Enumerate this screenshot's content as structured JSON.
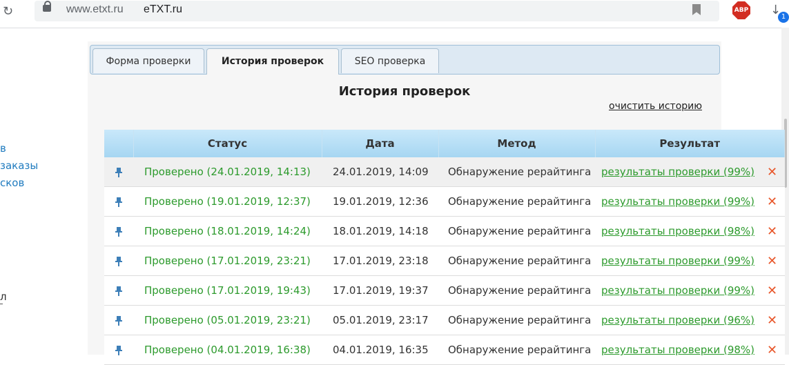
{
  "browser": {
    "url_domain": "www.etxt.ru",
    "page_title": "eTXT.ru",
    "abp_label": "ABP",
    "downloads_badge": "1"
  },
  "sidebar": {
    "fragments": [
      "в",
      "заказы",
      "сков",
      "л"
    ]
  },
  "tabs": [
    {
      "label": "Форма проверки",
      "active": false
    },
    {
      "label": "История проверок",
      "active": true
    },
    {
      "label": "SEO проверка",
      "active": false
    }
  ],
  "heading": "История проверок",
  "clear_link": "очистить историю",
  "table": {
    "headers": [
      "Статус",
      "Дата",
      "Метод",
      "Результат"
    ],
    "rows": [
      {
        "status": "Проверено (24.01.2019, 14:13)",
        "date": "24.01.2019, 14:09",
        "method": "Обнаружение рерайтинга",
        "result": "результаты проверки (99%)"
      },
      {
        "status": "Проверено (19.01.2019, 12:37)",
        "date": "19.01.2019, 12:36",
        "method": "Обнаружение рерайтинга",
        "result": "результаты проверки (99%)"
      },
      {
        "status": "Проверено (18.01.2019, 14:24)",
        "date": "18.01.2019, 14:18",
        "method": "Обнаружение рерайтинга",
        "result": "результаты проверки (98%)"
      },
      {
        "status": "Проверено (17.01.2019, 23:21)",
        "date": "17.01.2019, 23:18",
        "method": "Обнаружение рерайтинга",
        "result": "результаты проверки (99%)"
      },
      {
        "status": "Проверено (17.01.2019, 19:43)",
        "date": "17.01.2019, 19:37",
        "method": "Обнаружение рерайтинга",
        "result": "результаты проверки (99%)"
      },
      {
        "status": "Проверено (05.01.2019, 23:21)",
        "date": "05.01.2019, 23:17",
        "method": "Обнаружение рерайтинга",
        "result": "результаты проверки (96%)"
      },
      {
        "status": "Проверено (04.01.2019, 16:38)",
        "date": "04.01.2019, 16:35",
        "method": "Обнаружение рерайтинга",
        "result": "результаты проверки (98%)"
      }
    ]
  },
  "colors": {
    "status_green": "#2c9a2c",
    "link_blue": "#1f7bbf",
    "delete_orange": "#e8562a",
    "header_blue": "#a6d6f2"
  },
  "icons": {
    "pin": "pin-icon",
    "delete": "delete-icon"
  }
}
